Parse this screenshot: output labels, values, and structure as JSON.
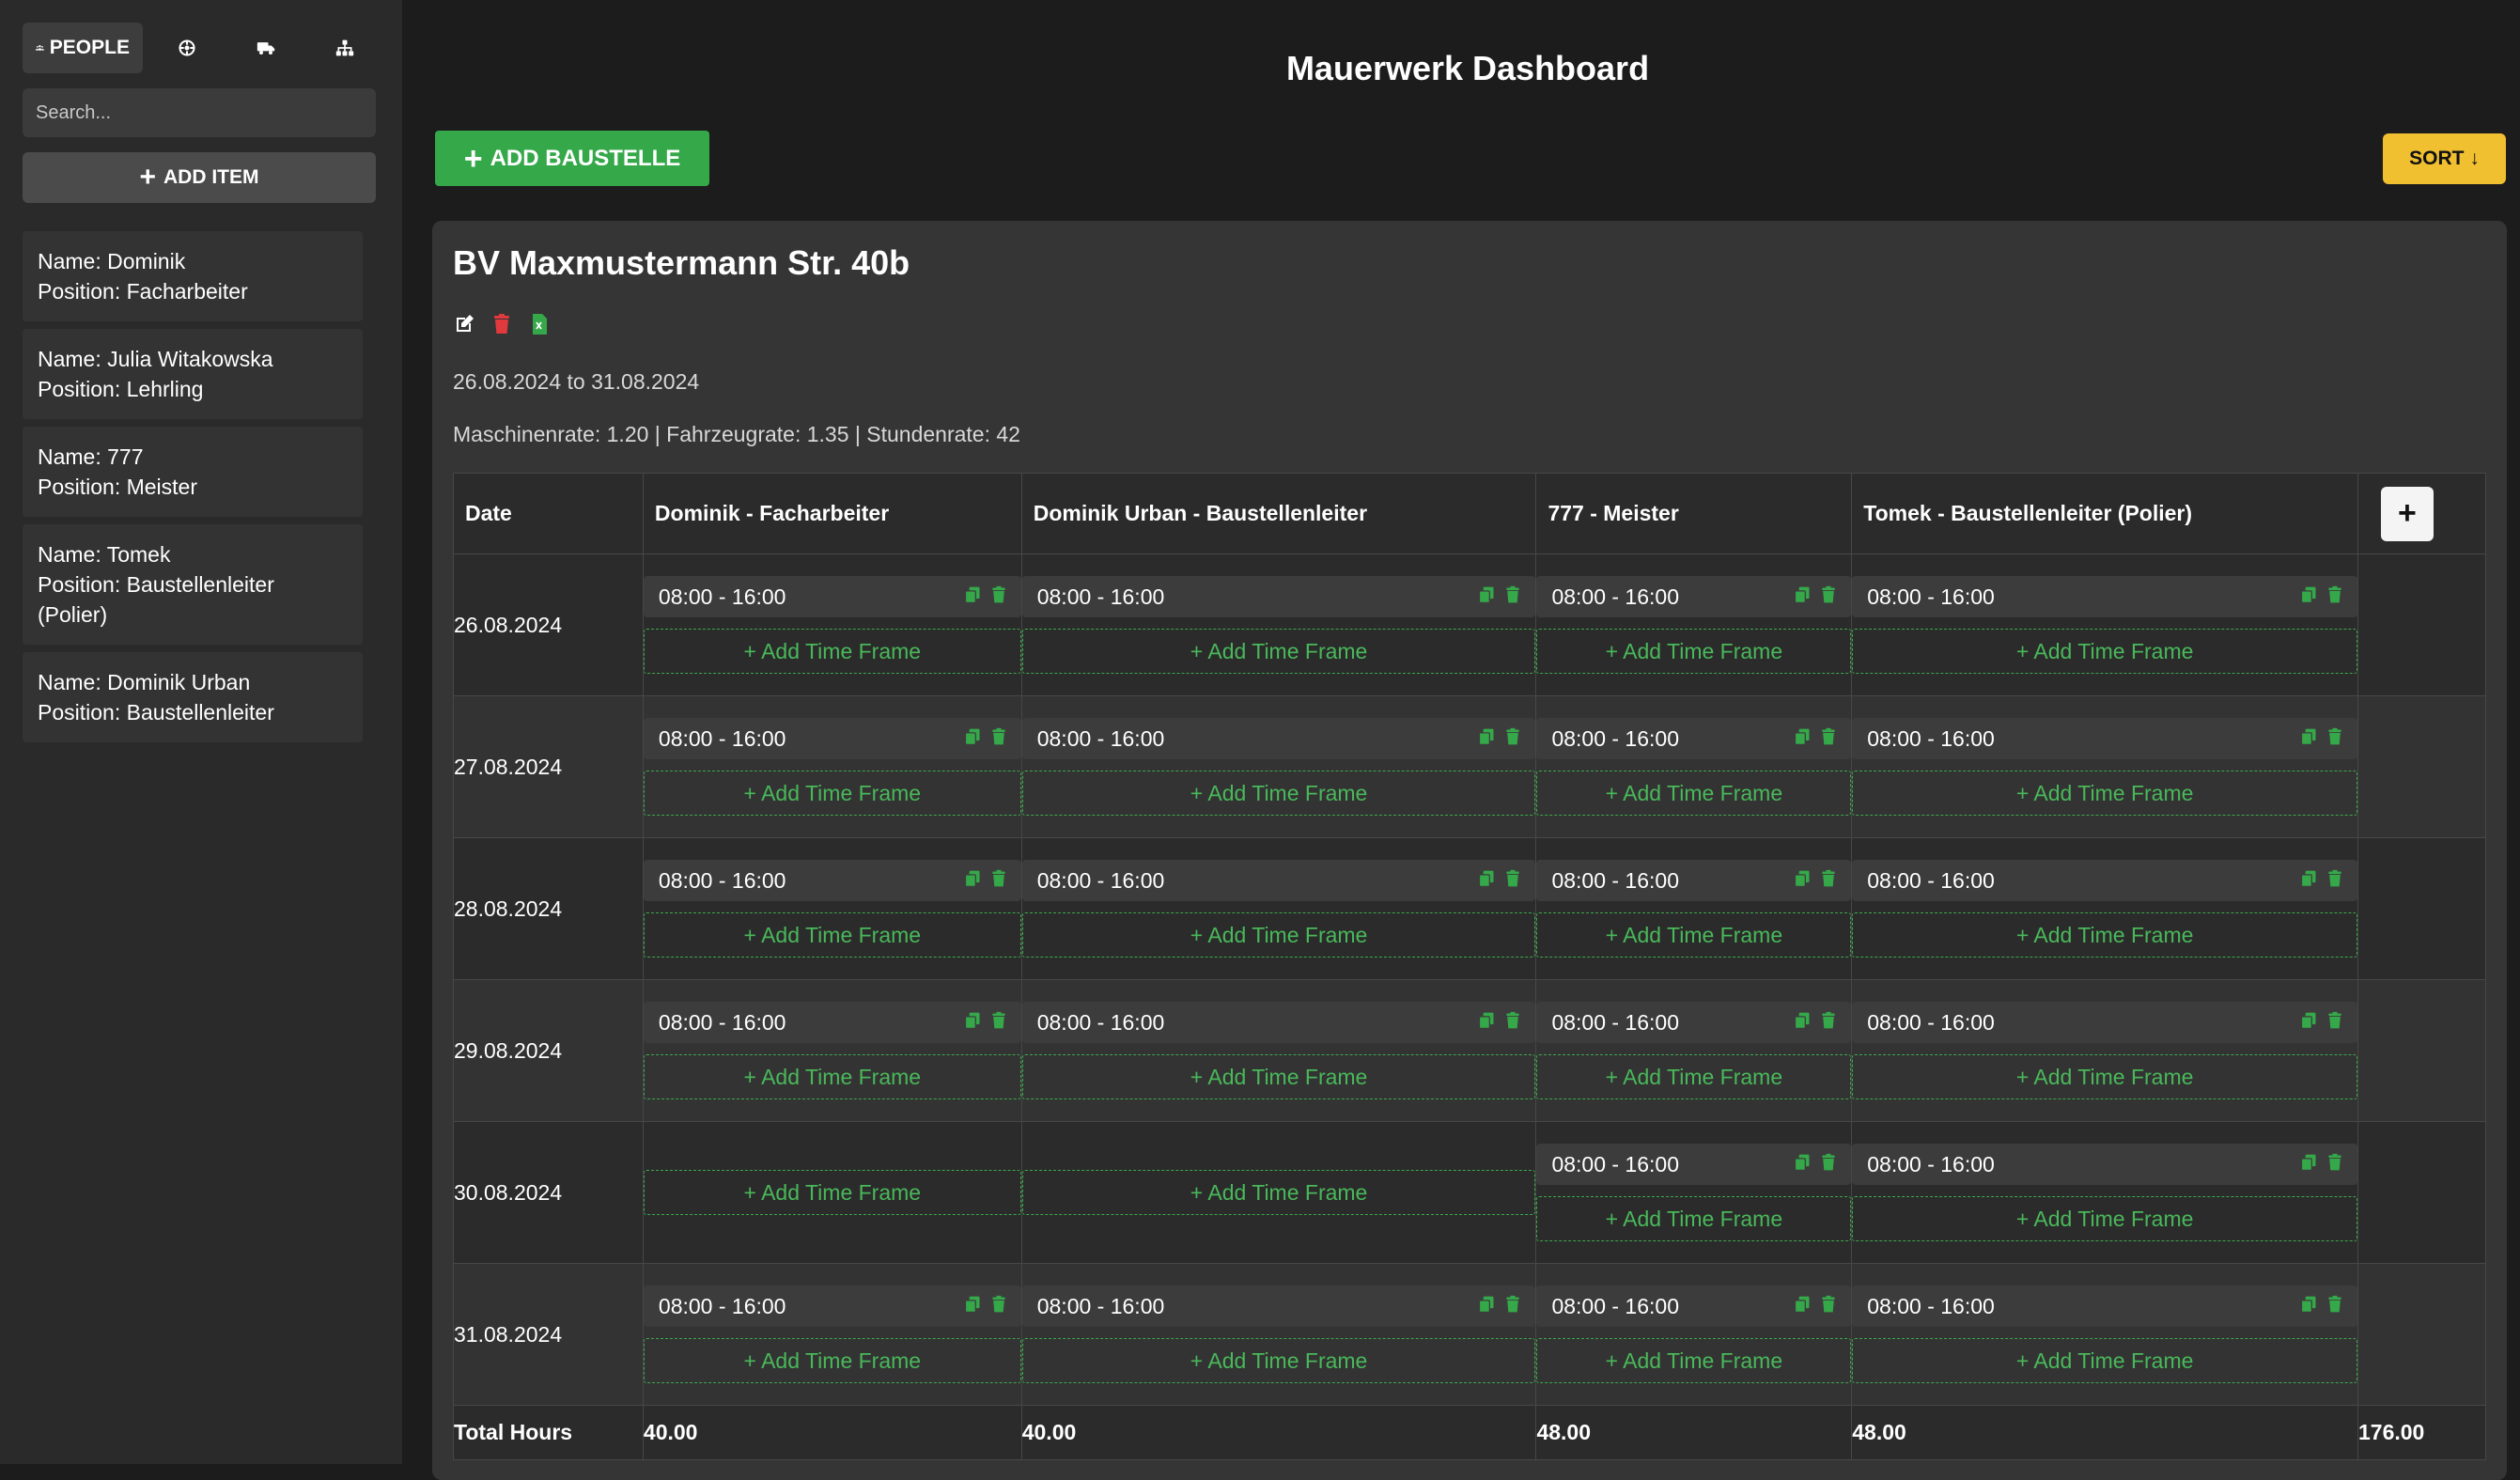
{
  "sidebar": {
    "tabs": [
      {
        "label": "PEOPLE",
        "icon": "people-icon"
      },
      {
        "label": "",
        "icon": "machine-icon"
      },
      {
        "label": "",
        "icon": "truck-icon"
      },
      {
        "label": "",
        "icon": "sitemap-icon"
      }
    ],
    "search_placeholder": "Search...",
    "add_item_label": "ADD ITEM",
    "people": [
      {
        "name": "Name: Dominik",
        "position": "Position: Facharbeiter"
      },
      {
        "name": "Name: Julia Witakowska",
        "position": "Position: Lehrling"
      },
      {
        "name": "Name: 777",
        "position": "Position: Meister"
      },
      {
        "name": "Name: Tomek",
        "position": "Position: Baustellenleiter (Polier)"
      },
      {
        "name": "Name: Dominik Urban",
        "position": "Position: Baustellenleiter"
      }
    ]
  },
  "header": {
    "title": "Mauerwerk Dashboard",
    "add_baustelle_label": "ADD BAUSTELLE",
    "sort_label": "SORT ↓"
  },
  "baustelle": {
    "title": "BV Maxmustermann Str. 40b",
    "date_range": "26.08.2024 to 31.08.2024",
    "rates": "Maschinenrate: 1.20 | Fahrzeugrate: 1.35 | Stundenrate: 42",
    "columns": {
      "date": "Date",
      "people": [
        "Dominik - Facharbeiter",
        "Dominik Urban - Baustellenleiter",
        "777 - Meister",
        "Tomek - Baustellenleiter (Polier)"
      ],
      "add_column": "+"
    },
    "add_time_frame_label": "+ Add Time Frame",
    "rows": [
      {
        "date": "26.08.2024",
        "cells": [
          [
            "08:00 - 16:00"
          ],
          [
            "08:00 - 16:00"
          ],
          [
            "08:00 - 16:00"
          ],
          [
            "08:00 - 16:00"
          ]
        ]
      },
      {
        "date": "27.08.2024",
        "cells": [
          [
            "08:00 - 16:00"
          ],
          [
            "08:00 - 16:00"
          ],
          [
            "08:00 - 16:00"
          ],
          [
            "08:00 - 16:00"
          ]
        ]
      },
      {
        "date": "28.08.2024",
        "cells": [
          [
            "08:00 - 16:00"
          ],
          [
            "08:00 - 16:00"
          ],
          [
            "08:00 - 16:00"
          ],
          [
            "08:00 - 16:00"
          ]
        ]
      },
      {
        "date": "29.08.2024",
        "cells": [
          [
            "08:00 - 16:00"
          ],
          [
            "08:00 - 16:00"
          ],
          [
            "08:00 - 16:00"
          ],
          [
            "08:00 - 16:00"
          ]
        ]
      },
      {
        "date": "30.08.2024",
        "cells": [
          [],
          [],
          [
            "08:00 - 16:00"
          ],
          [
            "08:00 - 16:00"
          ]
        ]
      },
      {
        "date": "31.08.2024",
        "cells": [
          [
            "08:00 - 16:00"
          ],
          [
            "08:00 - 16:00"
          ],
          [
            "08:00 - 16:00"
          ],
          [
            "08:00 - 16:00"
          ]
        ]
      }
    ],
    "totals": {
      "label": "Total Hours",
      "values": [
        "40.00",
        "40.00",
        "48.00",
        "48.00"
      ],
      "grand_total": "176.00"
    }
  },
  "colors": {
    "accent_green": "#35a84a",
    "sort_yellow": "#f0c030",
    "delete_red": "#e0393e"
  }
}
